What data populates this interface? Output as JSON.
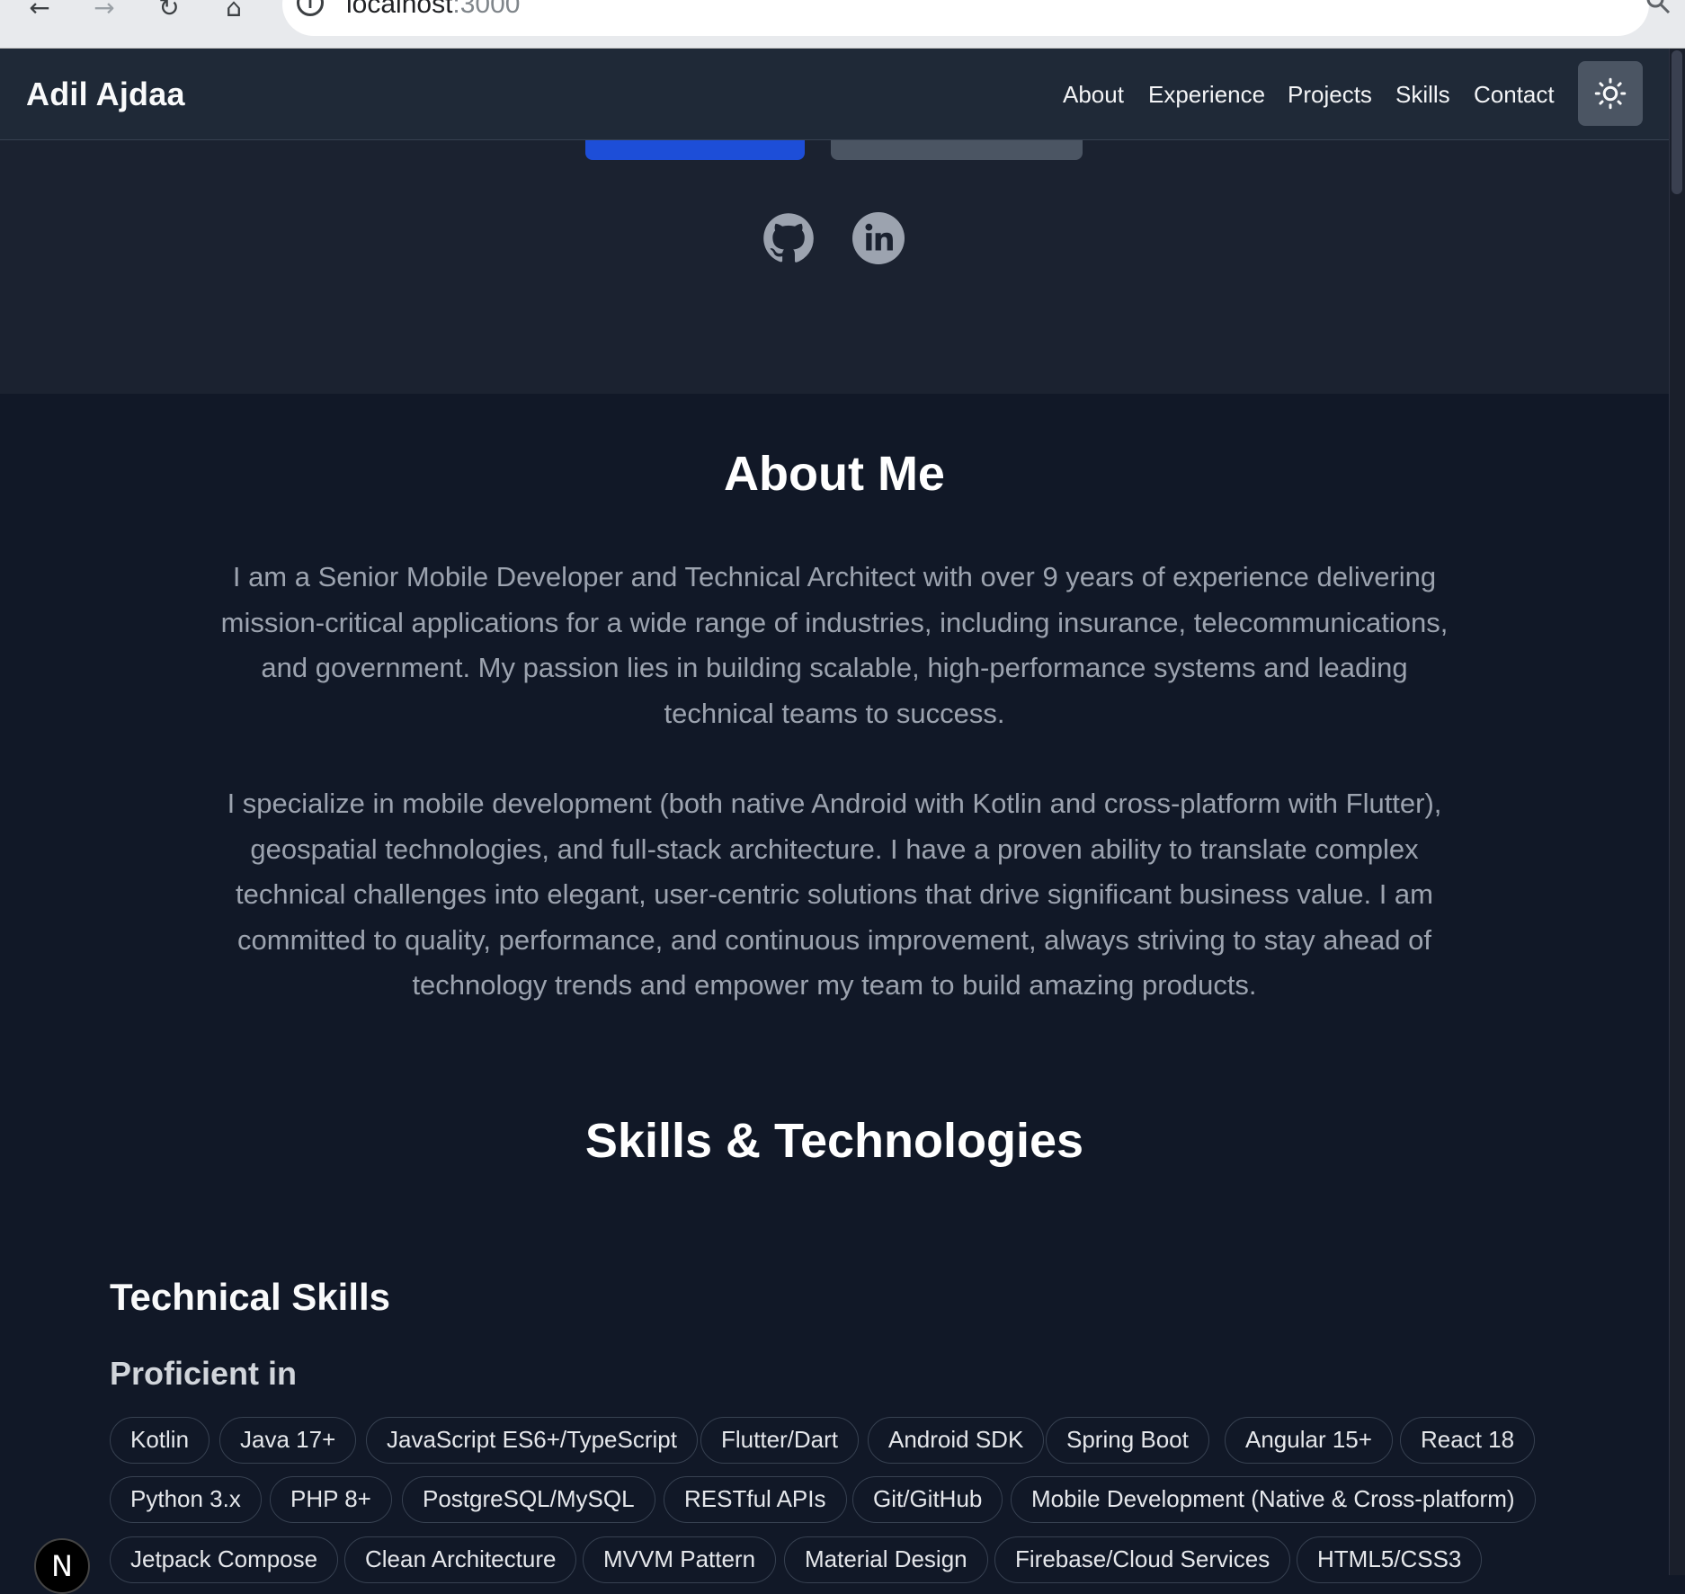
{
  "browser": {
    "url_host": "localhost",
    "url_port": ":3000",
    "back_icon": "←",
    "forward_icon": "→",
    "reload_icon": "↻",
    "home_icon": "⌂",
    "info_icon": "i"
  },
  "nav": {
    "brand": "Adil Ajdaa",
    "links": [
      "About",
      "Experience",
      "Projects",
      "Skills",
      "Contact"
    ]
  },
  "about": {
    "title": "About Me",
    "paragraphs": [
      "I am a Senior Mobile Developer and Technical Architect with over 9 years of experience delivering mission-critical applications for a wide range of industries, including insurance, telecommunications, and government. My passion lies in building scalable, high-performance systems and leading technical teams to success.",
      "I specialize in mobile development (both native Android with Kotlin and cross-platform with Flutter), geospatial technologies, and full-stack architecture. I have a proven ability to translate complex technical challenges into elegant, user-centric solutions that drive significant business value. I am committed to quality, performance, and continuous improvement, always striving to stay ahead of technology trends and empower my team to build amazing products."
    ]
  },
  "skills": {
    "title": "Skills & Technologies",
    "technical_title": "Technical Skills",
    "proficient_title": "Proficient in",
    "chips": [
      "Kotlin",
      "Java 17+",
      "JavaScript ES6+/TypeScript",
      "Flutter/Dart",
      "Android SDK",
      "Spring Boot",
      "Angular 15+",
      "React 18",
      "Python 3.x",
      "PHP 8+",
      "PostgreSQL/MySQL",
      "RESTful APIs",
      "Git/GitHub",
      "Mobile Development (Native & Cross-platform)",
      "Jetpack Compose",
      "Clean Architecture",
      "MVVM Pattern",
      "Material Design",
      "Firebase/Cloud Services",
      "HTML5/CSS3"
    ]
  },
  "next_badge": "N",
  "colors": {
    "page_bg": "#111827",
    "nav_bg": "#1f2937",
    "primary_button": "#1d4ed8",
    "secondary_button": "#4b5563",
    "body_text": "#9ca3af"
  }
}
